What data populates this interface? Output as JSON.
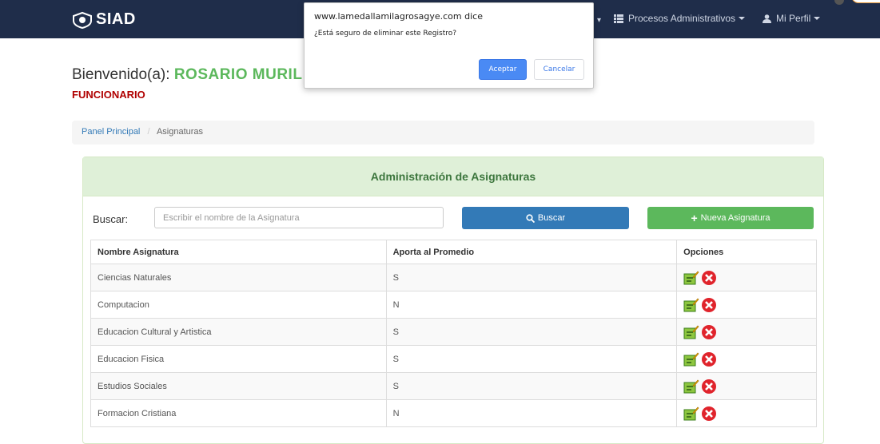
{
  "navbar": {
    "brand": "SIAD",
    "procesos": "Procesos Administrativos",
    "perfil": "Mi Perfil"
  },
  "welcome": {
    "prefix": "Bienvenido(a):",
    "name": "ROSARIO MURIL",
    "role": "FUNCIONARIO"
  },
  "breadcrumb": {
    "home": "Panel Principal",
    "sep": "/",
    "current": "Asignaturas"
  },
  "panel": {
    "title": "Administración de Asignaturas",
    "search_label": "Buscar:",
    "search_placeholder": "Escribir el nombre de la Asignatura",
    "search_button": "Buscar",
    "new_button": "Nueva Asignatura"
  },
  "table": {
    "headers": [
      "Nombre Asignatura",
      "Aporta al Promedio",
      "Opciones"
    ],
    "rows": [
      {
        "nombre": "Ciencias Naturales",
        "aporta": "S"
      },
      {
        "nombre": "Computacion",
        "aporta": "N"
      },
      {
        "nombre": "Educacion Cultural y Artistica",
        "aporta": "S"
      },
      {
        "nombre": "Educacion Fisica",
        "aporta": "S"
      },
      {
        "nombre": "Estudios Sociales",
        "aporta": "S"
      },
      {
        "nombre": "Formacion Cristiana",
        "aporta": "N"
      }
    ]
  },
  "dialog": {
    "origin": "www.lamedallamilagrosagye.com dice",
    "message": "¿Está seguro de eliminar este Registro?",
    "ok": "Aceptar",
    "cancel": "Cancelar"
  },
  "colors": {
    "navbar": "#1f2d4a",
    "success": "#5cb85c",
    "primary": "#337ab7",
    "danger": "#e0242c",
    "role": "#b00000"
  }
}
